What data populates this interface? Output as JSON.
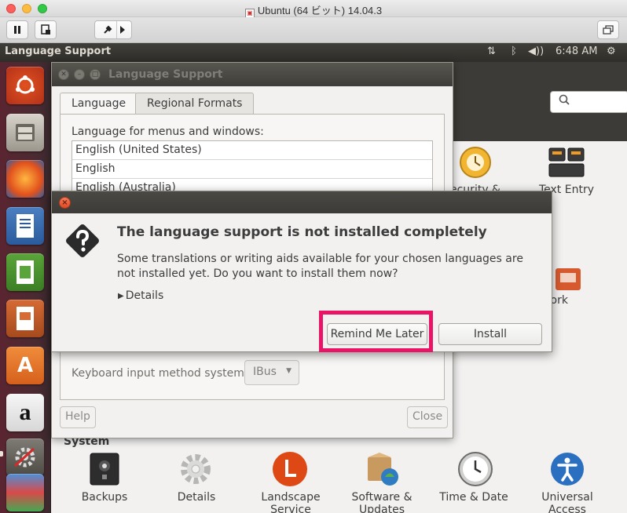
{
  "host_window": {
    "title": "Ubuntu (64 ビット) 14.04.3"
  },
  "panel": {
    "app_title": "Language Support",
    "time": "6:48 AM"
  },
  "launcher": {
    "items": [
      "ubuntu-logo-icon",
      "files-icon",
      "firefox-icon",
      "writer-icon",
      "calc-icon",
      "impress-icon",
      "software-center-icon",
      "amazon-icon",
      "system-settings-icon",
      "workspaces-icon"
    ]
  },
  "settings": {
    "search_icon": "search-icon",
    "visible_items": [
      {
        "label": "ecurity &",
        "icon": "security-icon"
      },
      {
        "label": "Text Entry",
        "icon": "keyboard-icon"
      },
      {
        "label": "etwork",
        "icon": "network-icon"
      }
    ],
    "system_heading": "System",
    "system_items": [
      {
        "label": "Backups",
        "icon": "safe-icon"
      },
      {
        "label": "Details",
        "icon": "gear-icon"
      },
      {
        "label": "Landscape Service",
        "icon": "landscape-icon"
      },
      {
        "label": "Software & Updates",
        "icon": "software-updates-icon"
      },
      {
        "label": "Time & Date",
        "icon": "clock-icon"
      },
      {
        "label": "Universal Access",
        "icon": "accessibility-icon"
      }
    ]
  },
  "language_window": {
    "title": "Language Support",
    "tabs": [
      {
        "label": "Language",
        "active": true
      },
      {
        "label": "Regional Formats",
        "active": false
      }
    ],
    "list_label": "Language for menus and windows:",
    "languages": [
      "English (United States)",
      "English",
      "English (Australia)"
    ],
    "keyboard_label": "Keyboard input method system:",
    "keyboard_value": "IBus",
    "help_label": "Help",
    "close_label": "Close"
  },
  "dialog": {
    "heading": "The language support is not installed completely",
    "body": "Some translations or writing aids available for your chosen languages are not installed yet. Do you want to install them now?",
    "details_label": "Details",
    "remind_label": "Remind Me Later",
    "install_label": "Install",
    "highlight_color": "#ea1467"
  }
}
